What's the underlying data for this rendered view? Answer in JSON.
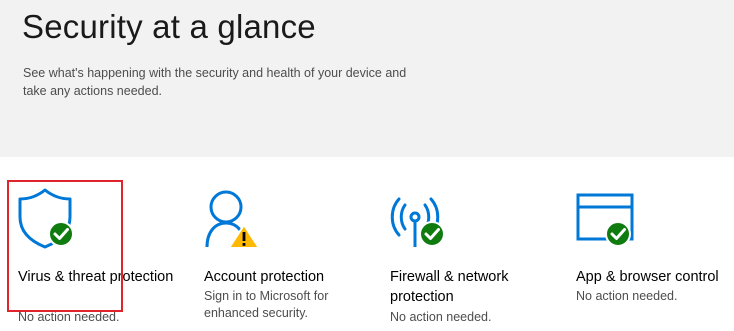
{
  "header": {
    "title": "Security at a glance",
    "subtitle": "See what's happening with the security and health of your device and take any actions needed."
  },
  "tiles": [
    {
      "name": "Virus & threat protection",
      "status": "No action needed.",
      "icon": "shield-icon",
      "badge": "check-icon"
    },
    {
      "name": "Account protection",
      "status": "Sign in to Microsoft for enhanced security.",
      "icon": "person-icon",
      "badge": "warning-icon"
    },
    {
      "name": "Firewall & network protection",
      "status": "No action needed.",
      "icon": "antenna-icon",
      "badge": "check-icon"
    },
    {
      "name": "App & browser control",
      "status": "No action needed.",
      "icon": "browser-window-icon",
      "badge": "check-icon"
    }
  ],
  "colors": {
    "accent": "#0078d7",
    "ok": "#107c10",
    "warning": "#ffb900",
    "highlight": "#e0242b"
  }
}
